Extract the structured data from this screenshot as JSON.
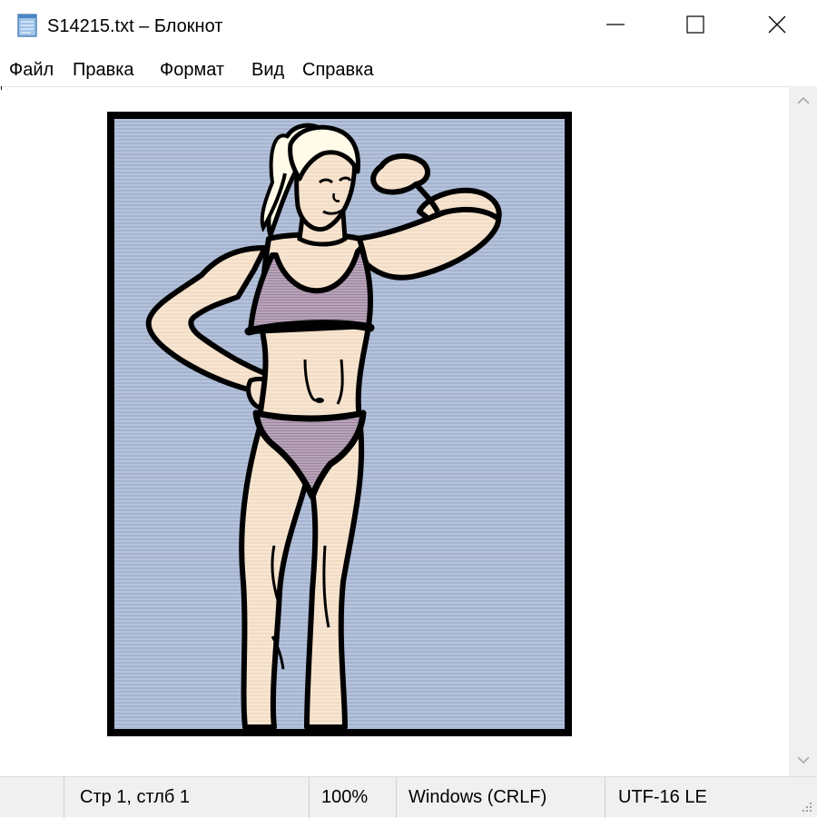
{
  "window": {
    "title": "S14215.txt – Блокнот",
    "icon": "notepad-icon",
    "controls": {
      "minimize": "minimize-icon",
      "maximize": "maximize-icon",
      "close": "close-icon"
    }
  },
  "menu": {
    "items": [
      "Файл",
      "Правка",
      "Формат",
      "Вид",
      "Справка"
    ]
  },
  "document": {
    "content": "ascii-art-image-of-woman-flexing-bicep",
    "colors": {
      "background": "#a4b3cf",
      "skin": "#f3dcc4",
      "garment": "#b8a3b8",
      "outline": "#000000"
    }
  },
  "scrollbar": {
    "up": "chevron-up-icon",
    "down": "chevron-down-icon"
  },
  "status": {
    "position": "Стр 1, стлб 1",
    "zoom": "100%",
    "line_ending": "Windows (CRLF)",
    "encoding": "UTF-16 LE"
  }
}
